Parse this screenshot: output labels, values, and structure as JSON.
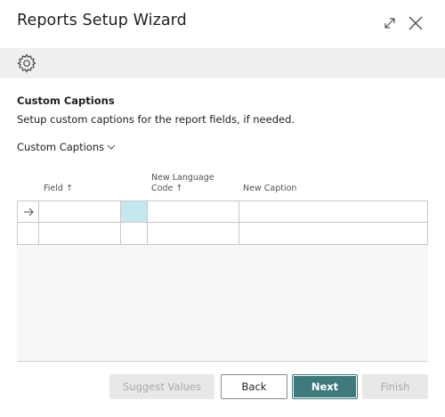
{
  "dialog": {
    "title": "Reports Setup Wizard"
  },
  "icons": {
    "expand": "expand-icon",
    "close": "close-icon",
    "settings": "gear-icon",
    "row_pointer": "arrow-right-icon",
    "part_toggle": "chevron-down-icon"
  },
  "section": {
    "title": "Custom Captions",
    "description": "Setup custom captions for the report fields, if needed."
  },
  "part": {
    "caption": "Custom Captions"
  },
  "grid": {
    "columns": {
      "field": "Field ↑",
      "new_language_code_line1": "New Language",
      "new_language_code_line2": "Code ↑",
      "new_caption": "New Caption"
    },
    "rows": [
      {
        "field": "",
        "new_language_code": "",
        "new_caption": ""
      },
      {
        "field": "",
        "new_language_code": "",
        "new_caption": ""
      }
    ]
  },
  "footer": {
    "suggest_values": "Suggest Values",
    "back": "Back",
    "next": "Next",
    "finish": "Finish"
  },
  "colors": {
    "primary": "#3e7a7c",
    "toolbar_bg": "#efefef",
    "selected_cell": "#c5e8f0",
    "disabled_bg": "#e8e8e8"
  }
}
